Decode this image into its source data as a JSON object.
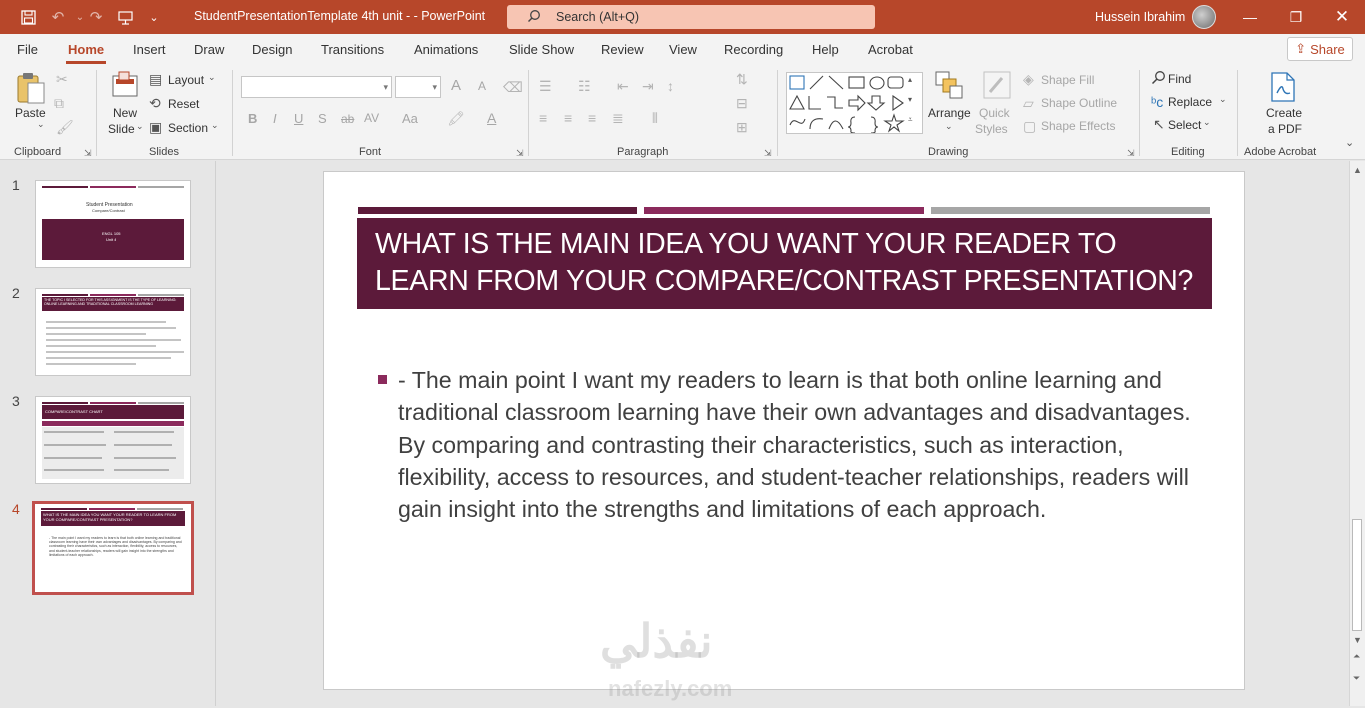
{
  "window": {
    "doc_title": "StudentPresentationTemplate 4th unit -  -  PowerPoint",
    "search_placeholder": "Search (Alt+Q)",
    "user_name": "Hussein Ibrahim"
  },
  "tabs": [
    "File",
    "Home",
    "Insert",
    "Draw",
    "Design",
    "Transitions",
    "Animations",
    "Slide Show",
    "Review",
    "View",
    "Recording",
    "Help",
    "Acrobat"
  ],
  "active_tab": "Home",
  "share_label": "Share",
  "ribbon": {
    "clipboard": {
      "paste": "Paste",
      "group": "Clipboard"
    },
    "slides": {
      "new_slide_1": "New",
      "new_slide_2": "Slide",
      "layout": "Layout",
      "reset": "Reset",
      "section": "Section",
      "group": "Slides"
    },
    "font": {
      "bold": "B",
      "italic": "I",
      "underline": "U",
      "shadow": "S",
      "strike": "ab",
      "spacing": "AV",
      "case": "Aa",
      "grow": "A",
      "shrink": "A",
      "font_color": "A",
      "group": "Font"
    },
    "paragraph": {
      "group": "Paragraph"
    },
    "drawing": {
      "arrange": "Arrange",
      "quick_styles_1": "Quick",
      "quick_styles_2": "Styles",
      "shape_fill": "Shape Fill",
      "shape_outline": "Shape Outline",
      "shape_effects": "Shape Effects",
      "group": "Drawing"
    },
    "editing": {
      "find": "Find",
      "replace": "Replace",
      "select": "Select",
      "group": "Editing"
    },
    "acrobat": {
      "create_1": "Create",
      "create_2": "a PDF",
      "group": "Adobe Acrobat"
    }
  },
  "slides": [
    {
      "number": "1",
      "title": "Student Presentation",
      "subtitle": "Compare/Contrast",
      "box_1": "ENGL 105",
      "box_2": "Unit 4"
    },
    {
      "number": "2",
      "title": "THE TOPIC I SELECTED FOR THIS ASSIGNMENT IS THE TYPE OF LEARNING: ONLINE LEARNING AND TRADITIONAL CLASSROOM LEARNING"
    },
    {
      "number": "3",
      "title": "COMPARE/CONTRAST CHART"
    },
    {
      "number": "4",
      "title": "WHAT IS THE MAIN IDEA YOU WANT YOUR READER TO LEARN FROM YOUR COMPARE/CONTRAST PRESENTATION?"
    }
  ],
  "active_slide": "4",
  "current_slide": {
    "title": "WHAT IS THE MAIN IDEA YOU WANT YOUR READER TO LEARN FROM YOUR COMPARE/CONTRAST PRESENTATION?",
    "body": "- The main point I want my readers to learn is that both online learning and traditional classroom learning have their own advantages and disadvantages. By comparing and contrasting their characteristics, such as interaction, flexibility, access to resources, and student-teacher relationships, readers will gain insight into the strengths and limitations of each approach."
  },
  "watermark": {
    "arabic": "نفذلي",
    "latin": "nafezly.com"
  },
  "colors": {
    "accent": "#b7472a",
    "title_box": "#5c1a3a",
    "bar_1": "#5c1a3a",
    "bar_2": "#8b2a5c",
    "bar_3": "#a6a6a6"
  }
}
